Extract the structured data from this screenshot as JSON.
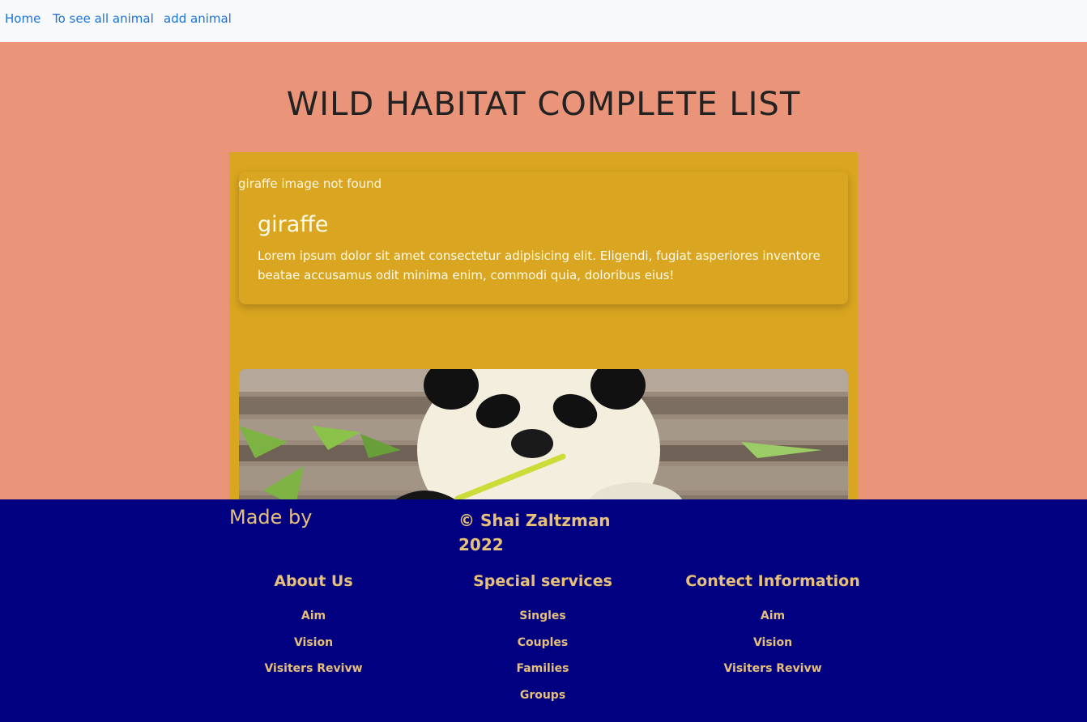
{
  "nav": {
    "links": [
      "Home",
      "To see all animal",
      "add animal"
    ]
  },
  "page_title": "WILD HABITAT COMPLETE LIST",
  "animals": [
    {
      "image_alt": "giraffe image not found",
      "name": "giraffe",
      "description": "Lorem ipsum dolor sit amet consectetur adipisicing elit. Eligendi, fugiat asperiores inventore beatae accusamus odit minima enim, commodi quia, doloribus eius!"
    }
  ],
  "footer": {
    "made_by": "Made by",
    "copyright": "© Shai Zaltzman 2022",
    "columns": [
      {
        "title": "About Us",
        "items": [
          "Aim",
          "Vision",
          "Visiters Revivw"
        ]
      },
      {
        "title": "Special services",
        "items": [
          "Singles",
          "Couples",
          "Families",
          "Groups"
        ]
      },
      {
        "title": "Contect Information",
        "items": [
          "Aim",
          "Vision",
          "Visiters Revivw"
        ]
      }
    ]
  },
  "colors": {
    "nav_bg": "#f8f9fa",
    "link": "#1a73d9",
    "page_bg": "#ea947a",
    "panel_bg": "#daa520",
    "footer_bg": "#000080",
    "footer_text": "#e6c07b"
  }
}
